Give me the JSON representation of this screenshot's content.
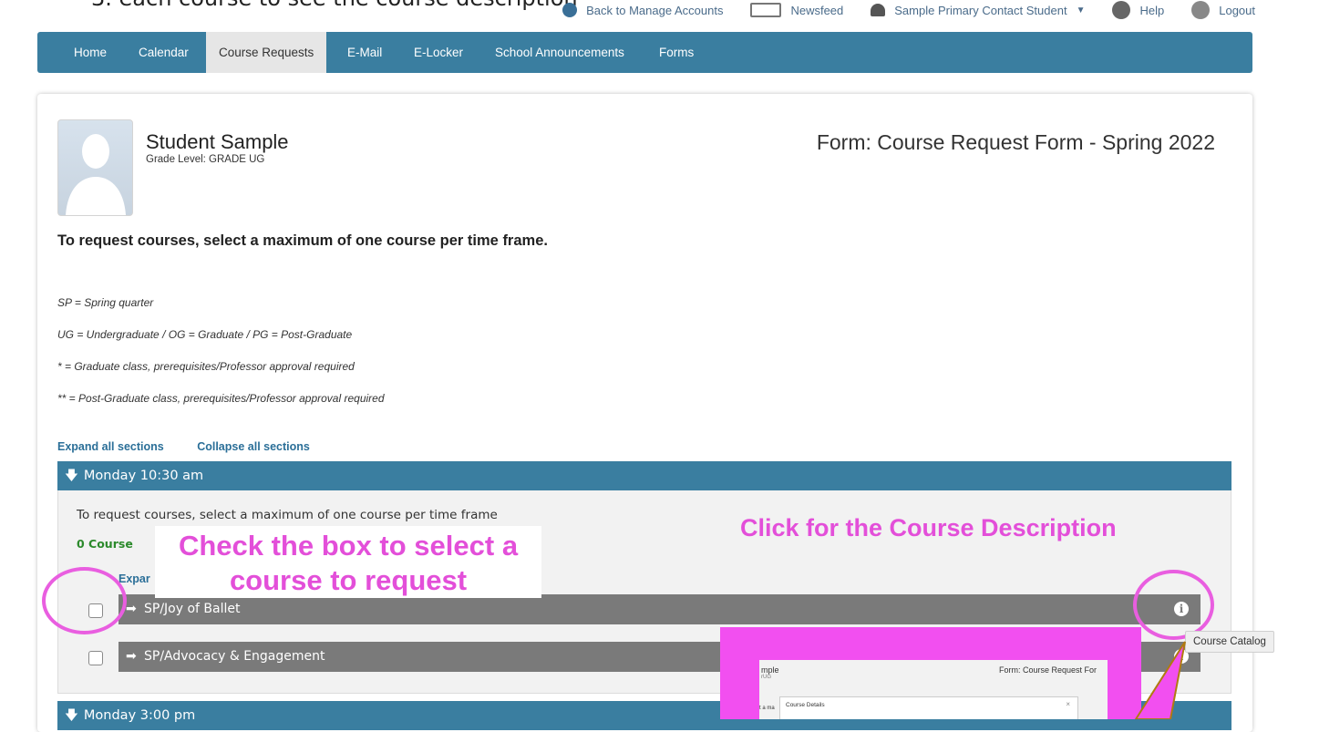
{
  "caption_partial": "3. each course to see the course description",
  "topbar": {
    "back_label": "Back to Manage Accounts",
    "newsfeed_label": "Newsfeed",
    "user_label": "Sample Primary Contact Student",
    "help_label": "Help",
    "logout_label": "Logout"
  },
  "nav": {
    "items": [
      "Home",
      "Calendar",
      "Course Requests",
      "E-Mail",
      "E-Locker",
      "School Announcements",
      "Forms"
    ],
    "active": "Course Requests"
  },
  "student": {
    "name": "Student Sample",
    "grade": "Grade Level: GRADE UG"
  },
  "form_title": "Form: Course Request Form - Spring 2022",
  "instruction": "To request courses, select a maximum of one course per time frame.",
  "legend": [
    "SP = Spring quarter",
    "UG = Undergraduate  /  OG = Graduate  /  PG = Post-Graduate",
    "* = Graduate class, prerequisites/Professor approval required",
    "** = Post-Graduate class, prerequisites/Professor approval required"
  ],
  "links": {
    "expand_all": "Expand all sections",
    "collapse_all": "Collapse all sections"
  },
  "sections": [
    {
      "title": "Monday 10:30 am",
      "body_text": "To request courses, select a maximum of one course per time frame",
      "count_text": "0 Course",
      "expand_partial": "Expar",
      "courses": [
        "SP/Joy of Ballet",
        "SP/Advocacy & Engagement"
      ]
    },
    {
      "title": "Monday 3:00 pm"
    }
  ],
  "annotations": {
    "check_box_note": "Check the box to select a course to request",
    "description_note": "Click for the Course Description"
  },
  "tooltip": "Course Catalog",
  "preview": {
    "name_partial": "mple",
    "grade_partial": "rUG",
    "form_title_partial": "Form: Course Request For",
    "modal_title": "Course Details",
    "close_symbol": "×",
    "side_partial": "t a ma"
  },
  "colors": {
    "nav_bg": "#3a7ea0",
    "section_header": "#3a7ea0",
    "course_row": "#7a7a7a",
    "annotation": "#e34fd9",
    "highlight": "#f24ff0",
    "count_green": "#2c8a2c",
    "link_blue": "#2b6f98"
  },
  "icons": [
    "back-arrow-icon",
    "newsfeed-icon",
    "user-icon",
    "help-icon",
    "logout-icon",
    "down-arrow-icon",
    "right-arrow-icon",
    "info-icon",
    "avatar-silhouette"
  ]
}
